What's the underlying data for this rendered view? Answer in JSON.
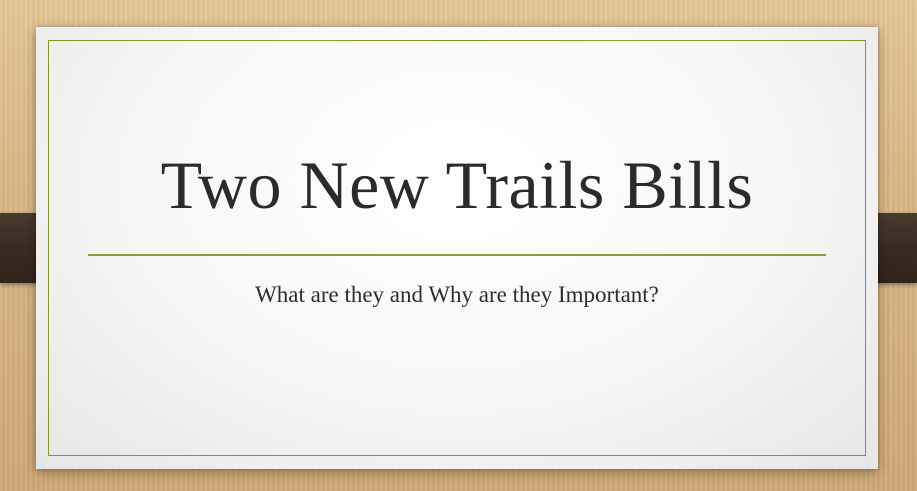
{
  "slide": {
    "title": "Two New Trails Bills",
    "subtitle": "What are they and Why are they Important?"
  },
  "colors": {
    "background_wood": "#d9b888",
    "strap": "#3a2c22",
    "card": "#f6f6f6",
    "accent_line": "#7f9a2a",
    "text": "#2b2b2b"
  }
}
